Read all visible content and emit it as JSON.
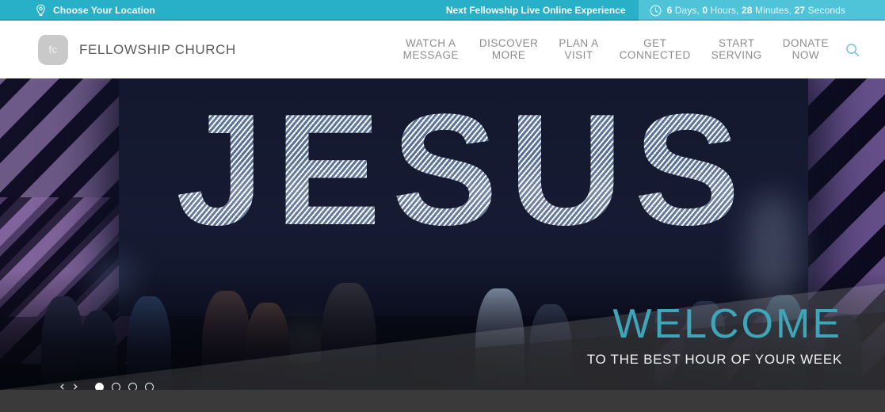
{
  "topbar": {
    "location_label": "Choose Your Location",
    "location_icon": "map-pin-icon",
    "next_live_label": "Next Fellowship Live Online Experience",
    "clock_icon": "clock-icon",
    "countdown": {
      "days_value": "6",
      "days_unit": " Days, ",
      "hours_value": "0",
      "hours_unit": " Hours, ",
      "minutes_value": "28",
      "minutes_unit": " Minutes, ",
      "seconds_value": "27",
      "seconds_unit": " Seconds"
    },
    "bg_color": "#29b0c9",
    "countdown_bg_color": "#4fc3d8"
  },
  "header": {
    "logo_text": "fc",
    "brand_name": "FELLOWSHIP CHURCH",
    "search_icon": "search-icon",
    "nav": [
      {
        "label": "WATCH A\nMESSAGE"
      },
      {
        "label": "DISCOVER\nMORE"
      },
      {
        "label": "PLAN A\nVISIT"
      },
      {
        "label": "GET\nCONNECTED"
      },
      {
        "label": "START\nSERVING"
      },
      {
        "label": "DONATE\nNOW"
      }
    ]
  },
  "hero": {
    "stage_text": "JESUS",
    "welcome_title": "WELCOME",
    "welcome_subtitle": "TO THE BEST HOUR OF YOUR WEEK",
    "welcome_color": "#3fa5b8",
    "prev_arrow": "‹",
    "next_arrow": "›",
    "slides": [
      {
        "active": true
      },
      {
        "active": false
      },
      {
        "active": false
      },
      {
        "active": false
      }
    ]
  }
}
